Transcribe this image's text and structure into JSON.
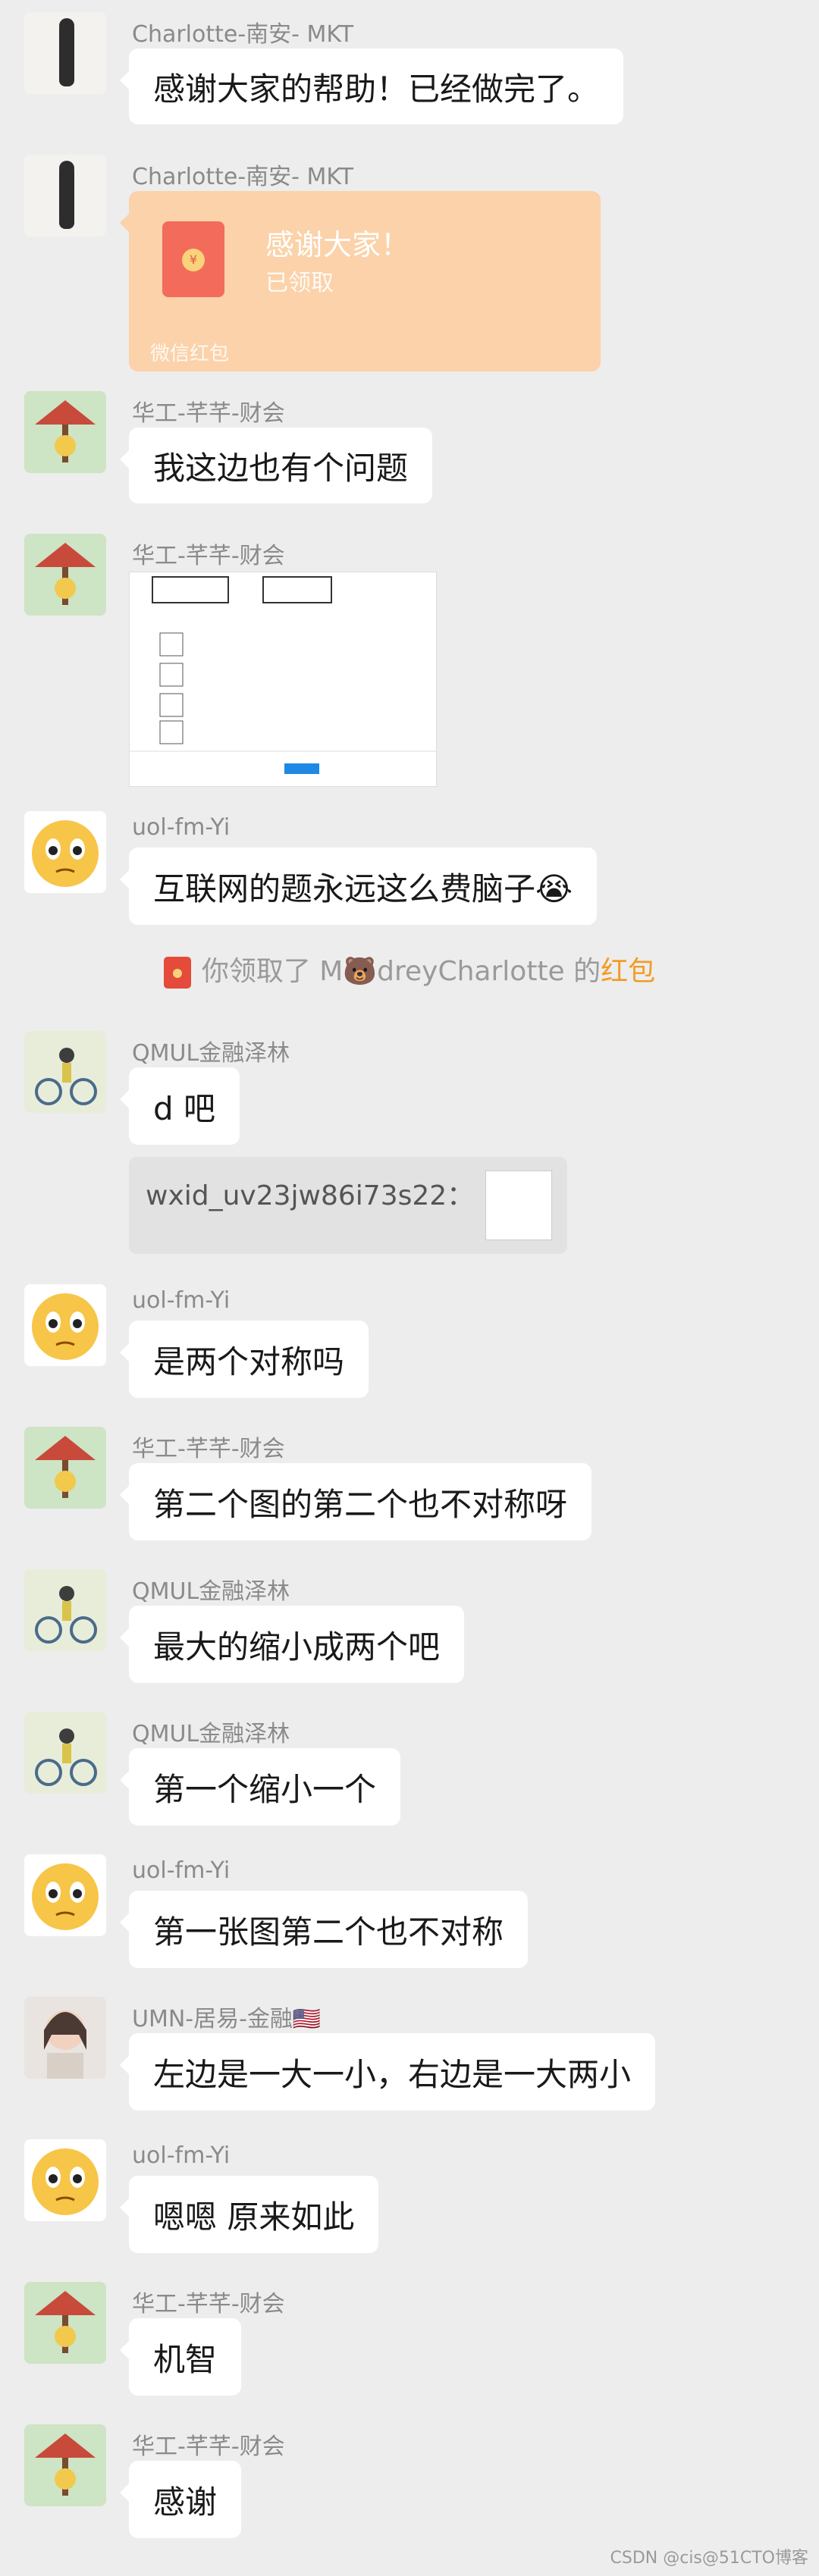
{
  "messages": [
    {
      "sender": "Charlotte-南安- MKT",
      "text": "感谢大家的帮助！已经做完了。"
    },
    {
      "sender": "Charlotte-南安- MKT",
      "red_packet": {
        "title": "感谢大家！",
        "status": "已领取",
        "footer": "微信红包"
      }
    },
    {
      "sender": "华工-芊芊-财会",
      "text": "我这边也有个问题"
    },
    {
      "sender": "华工-芊芊-财会",
      "image": "screenshot"
    },
    {
      "sender": "uol-fm-Yi",
      "text": "互联网的题永远这么费脑子😭"
    },
    {
      "sender": "QMUL金融泽林",
      "text": "d 吧",
      "quote": "wxid_uv23jw86i73s22："
    },
    {
      "sender": "uol-fm-Yi",
      "text": "是两个对称吗"
    },
    {
      "sender": "华工-芊芊-财会",
      "text": "第二个图的第二个也不对称呀"
    },
    {
      "sender": "QMUL金融泽林",
      "text": "最大的缩小成两个吧"
    },
    {
      "sender": "QMUL金融泽林",
      "text": "第一个缩小一个"
    },
    {
      "sender": "uol-fm-Yi",
      "text": "第一张图第二个也不对称"
    },
    {
      "sender": "UMN-居易-金融🇺🇸",
      "text": "左边是一大一小，右边是一大两小"
    },
    {
      "sender": "uol-fm-Yi",
      "text": "嗯嗯 原来如此"
    },
    {
      "sender": "华工-芊芊-财会",
      "text": "机智"
    },
    {
      "sender": "华工-芊芊-财会",
      "text": "感谢"
    }
  ],
  "system_notice": {
    "prefix": "你领取了 M🐻dreyCharlotte 的",
    "link": "红包"
  },
  "watermark": "CSDN @cis@51CTO博客"
}
